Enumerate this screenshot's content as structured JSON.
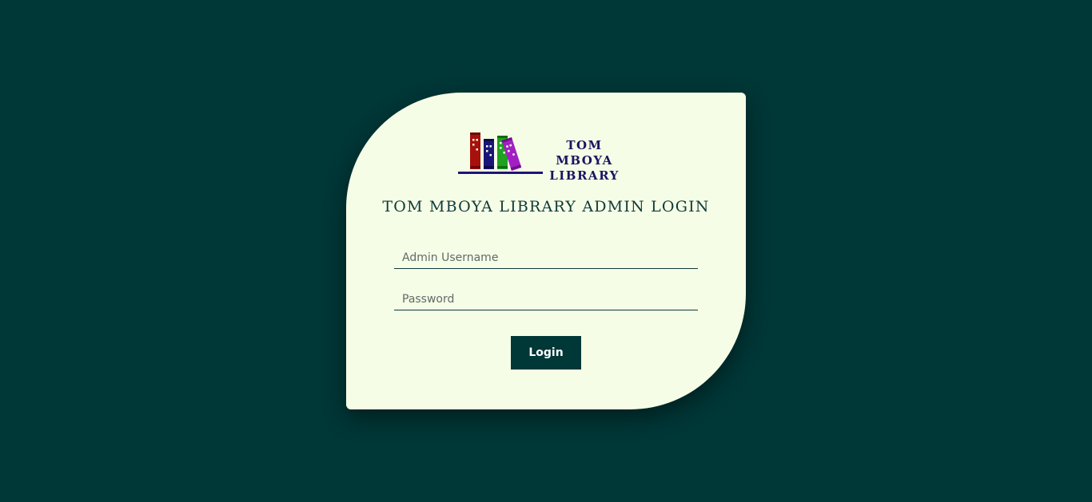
{
  "brand": {
    "logo_line1": "TOM MBOYA",
    "logo_line2": "LIBRARY",
    "logo_icon": "books-on-shelf-icon",
    "colors": {
      "book_red": "#a8100c",
      "book_navy": "#1a1677",
      "book_green": "#1fa21f",
      "book_purple": "#a31fc4",
      "shelf": "#1a1677",
      "logo_text": "#1a1561"
    }
  },
  "login": {
    "title": "TOM MBOYA LIBRARY ADMIN LOGIN",
    "username_placeholder": "Admin Username",
    "password_placeholder": "Password",
    "submit_label": "Login"
  },
  "theme": {
    "background": "#003737",
    "card_background": "#f6fde6",
    "accent": "#003737"
  }
}
